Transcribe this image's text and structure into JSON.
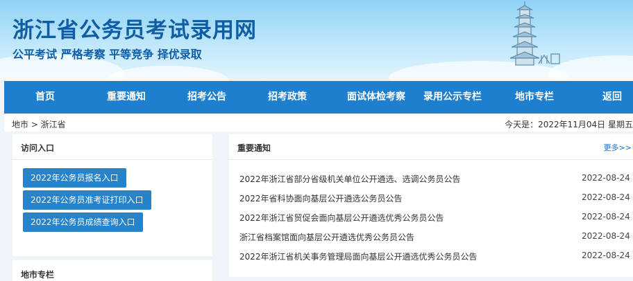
{
  "header": {
    "title": "浙江省公务员考试录用网",
    "slogan": "公平考试 严格考察 平等竞争 择优录取"
  },
  "nav": {
    "items": [
      "首页",
      "重要通知",
      "招考公告",
      "招考政策",
      "面试体检考察",
      "录用公示专栏",
      "地市专栏",
      "返回"
    ]
  },
  "breadcrumb": "地市 > 浙江省",
  "today": "今天是：2022年11月04日 星期五",
  "access": {
    "title": "访问入口",
    "buttons": [
      "2022年公务员报名入口",
      "2022年公务员准考证打印入口",
      "2022年公务员成绩查询入口"
    ]
  },
  "city": {
    "title": "地市专栏"
  },
  "notices": {
    "title": "重要通知",
    "more": "更多>>",
    "items": [
      {
        "title": "2022年浙江省部分省级机关单位公开遴选、选调公务员公告",
        "date": "2022-08-24"
      },
      {
        "title": "2022年省科协面向基层公开遴选公务员公告",
        "date": "2022-08-24"
      },
      {
        "title": "2022年浙江省贸促会面向基层公开遴选优秀公务员公告",
        "date": "2022-08-24"
      },
      {
        "title": "浙江省档案馆面向基层公开遴选优秀公务员公告",
        "date": "2022-08-24"
      },
      {
        "title": "2022年浙江省机关事务管理局面向基层公开遴选优秀公务员公告",
        "date": "2022-08-24"
      }
    ]
  },
  "colors": {
    "nav_bg": "#1f7fcf",
    "title_blue": "#0f5ea5",
    "button_bg": "#2583cc"
  }
}
